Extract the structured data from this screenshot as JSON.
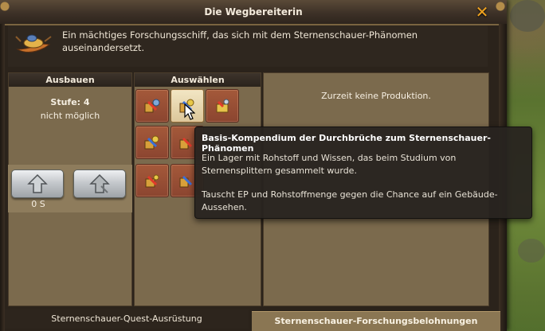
{
  "window": {
    "title": "Die Wegbereiterin",
    "close_icon": "close-x-icon",
    "description": "Ein mächtiges Forschungsschiff, das sich mit dem Sternenschauer-Phänomen auseinandersetzt.",
    "building_icon": "research-ship-icon"
  },
  "upgrade_panel": {
    "header": "Ausbauen",
    "level": "Stufe: 4",
    "status": "nicht möglich",
    "cost": "0 S",
    "buttons": [
      "upgrade-arrow-icon",
      "upgrade-arrow-disabled-icon"
    ]
  },
  "choose_panel": {
    "header": "Auswählen",
    "slots": [
      {
        "icon": "research-items-icon",
        "selected": false
      },
      {
        "icon": "research-items-icon",
        "selected": true
      },
      {
        "icon": "research-items-icon",
        "selected": false
      },
      {
        "icon": "research-items-icon",
        "selected": false
      },
      {
        "icon": "research-items-icon",
        "selected": false
      },
      {
        "icon": "research-items-icon",
        "selected": false
      }
    ]
  },
  "production_panel": {
    "status": "Zurzeit keine Produktion."
  },
  "tooltip": {
    "title": "Basis-Kompendium der Durchbrüche zum Sternenschauer-Phänomen",
    "line1": "Ein Lager mit Rohstoff und Wissen, das beim Studium von Sternensplittern gesammelt wurde.",
    "line2": "Tauscht EP und Rohstoffmenge gegen die Chance auf ein Gebäude-Aussehen."
  },
  "tabs": {
    "quest_equipment": "Sternenschauer-Quest-Ausrüstung",
    "research_rewards": "Sternenschauer-Forschungsbelohnungen",
    "active": "research_rewards"
  },
  "colors": {
    "accent": "#f0a31f",
    "panel": "#7b6a4d",
    "slot": "#a4593a",
    "slot_selected": "#f2e6c4"
  }
}
